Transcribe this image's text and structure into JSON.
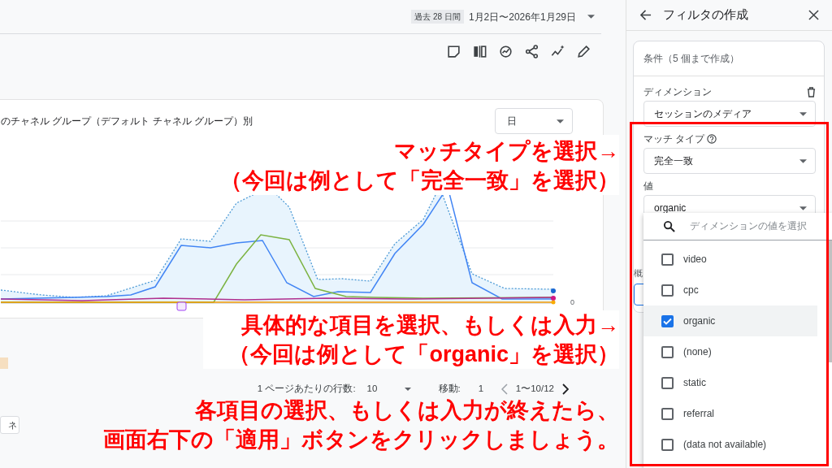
{
  "date_range": {
    "preset": "過去 28 日間",
    "range": "1月2日〜2026年1月29日"
  },
  "card": {
    "title": "のチャネル グループ（デフォルト チャネル グループ）別",
    "granularity": "日",
    "axis_zero": "0"
  },
  "table": {
    "partial_field": "ネ"
  },
  "pagination": {
    "rows_label": "1 ページあたりの行数:",
    "rows": "10",
    "goto_label": "移動:",
    "goto": "1",
    "range": "1〜10/12"
  },
  "filter_panel": {
    "title": "フィルタの作成",
    "conditions_label": "条件（5 個まで作成）",
    "dimension_label": "ディメンション",
    "dimension": "セッションのメディア",
    "match_type_label": "マッチ タイプ",
    "match_type": "完全一致",
    "value_label": "値",
    "value": "organic",
    "hidden_label": "概",
    "search_placeholder": "ディメンションの値を選択",
    "options": [
      {
        "label": "video",
        "checked": false
      },
      {
        "label": "cpc",
        "checked": false
      },
      {
        "label": "organic",
        "checked": true
      },
      {
        "label": "(none)",
        "checked": false
      },
      {
        "label": "static",
        "checked": false
      },
      {
        "label": "referral",
        "checked": false
      },
      {
        "label": "(data not available)",
        "checked": false
      }
    ]
  },
  "annotations": [
    {
      "lines": [
        "マッチタイプを選択→",
        "（今回は例として「完全一致」を選択）"
      ]
    },
    {
      "lines": [
        "具体的な項目を選択、もしくは入力→",
        "（今回は例として「organic」を選択）"
      ]
    },
    {
      "lines": [
        "各項目の選択、もしくは入力が終えたら、",
        "画面右下の「適用」ボタンをクリックしましょう。"
      ]
    }
  ]
}
